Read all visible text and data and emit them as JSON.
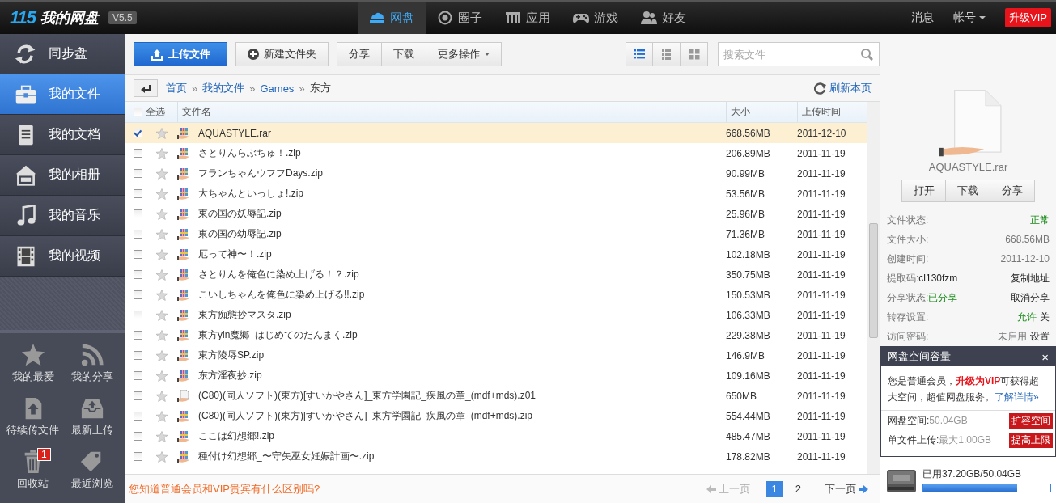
{
  "header": {
    "logo": "115",
    "title": "我的网盘",
    "version": "V5.5",
    "nav": [
      {
        "label": "网盘",
        "selected": true
      },
      {
        "label": "圈子",
        "selected": false
      },
      {
        "label": "应用",
        "selected": false
      },
      {
        "label": "游戏",
        "selected": false
      },
      {
        "label": "好友",
        "selected": false
      }
    ],
    "messages": "消息",
    "account": "帐号",
    "upgrade": "升级VIP"
  },
  "sidebar": {
    "items": [
      {
        "label": "同步盘",
        "selected": false
      },
      {
        "label": "我的文件",
        "selected": true
      },
      {
        "label": "我的文档",
        "selected": false
      },
      {
        "label": "我的相册",
        "selected": false
      },
      {
        "label": "我的音乐",
        "selected": false
      },
      {
        "label": "我的视频",
        "selected": false
      }
    ],
    "shortcuts": [
      {
        "label": "我的最爱"
      },
      {
        "label": "我的分享"
      },
      {
        "label": "待续传文件"
      },
      {
        "label": "最新上传"
      },
      {
        "label": "回收站",
        "badge": "1"
      },
      {
        "label": "最近浏览"
      }
    ]
  },
  "toolbar": {
    "upload": "上传文件",
    "new_folder": "新建文件夹",
    "actions": [
      "分享",
      "下载"
    ],
    "more": "更多操作",
    "views": [
      {
        "selected": true
      },
      {
        "selected": false
      },
      {
        "selected": false
      }
    ],
    "search": {
      "placeholder": "搜索文件"
    }
  },
  "breadcrumb": {
    "path": [
      {
        "label": "首页",
        "separator": "»"
      },
      {
        "label": "我的文件",
        "separator": "»"
      },
      {
        "label": "Games",
        "separator": "»"
      }
    ],
    "current": "东方",
    "refresh": "刷新本页"
  },
  "table": {
    "columns": [
      "全选",
      "文件名",
      "大小",
      "上传时间"
    ],
    "select_all_checked": false,
    "rows": [
      {
        "name": "AQUASTYLE.rar",
        "size": "668.56MB",
        "date": "2011-12-10",
        "kind": "archive",
        "checked": true
      },
      {
        "name": "さとりんらぶちゅ！.zip",
        "size": "206.89MB",
        "date": "2011-11-19",
        "kind": "archive",
        "checked": false
      },
      {
        "name": "フランちゃんウフフDays.zip",
        "size": "90.99MB",
        "date": "2011-11-19",
        "kind": "archive",
        "checked": false
      },
      {
        "name": "大ちゃんといっしょ!.zip",
        "size": "53.56MB",
        "date": "2011-11-19",
        "kind": "archive",
        "checked": false
      },
      {
        "name": "東の国の妖辱記.zip",
        "size": "25.96MB",
        "date": "2011-11-19",
        "kind": "archive",
        "checked": false
      },
      {
        "name": "東の国の幼辱記.zip",
        "size": "71.36MB",
        "date": "2011-11-19",
        "kind": "archive",
        "checked": false
      },
      {
        "name": "厄って神〜！.zip",
        "size": "102.18MB",
        "date": "2011-11-19",
        "kind": "archive",
        "checked": false
      },
      {
        "name": "さとりんを俺色に染め上げる！？.zip",
        "size": "350.75MB",
        "date": "2011-11-19",
        "kind": "archive",
        "checked": false
      },
      {
        "name": "こいしちゃんを俺色に染め上げる!!.zip",
        "size": "150.53MB",
        "date": "2011-11-19",
        "kind": "archive",
        "checked": false
      },
      {
        "name": "東方痴態抄マスタ.zip",
        "size": "106.33MB",
        "date": "2011-11-19",
        "kind": "archive",
        "checked": false
      },
      {
        "name": "東方yin魔鄉_はじめてのだんまく.zip",
        "size": "229.38MB",
        "date": "2011-11-19",
        "kind": "archive",
        "checked": false
      },
      {
        "name": "東方陵辱SP.zip",
        "size": "146.9MB",
        "date": "2011-11-19",
        "kind": "archive",
        "checked": false
      },
      {
        "name": "东方淫夜抄.zip",
        "size": "109.16MB",
        "date": "2011-11-19",
        "kind": "archive",
        "checked": false
      },
      {
        "name": "(C80)(同人ソフト)(東方)[すいかやさん]_東方学園記_疾風の章_(mdf+mds).z01",
        "size": "650MB",
        "date": "2011-11-19",
        "kind": "file",
        "checked": false
      },
      {
        "name": "(C80)(同人ソフト)(東方)[すいかやさん]_東方学園記_疾風の章_(mdf+mds).zip",
        "size": "554.44MB",
        "date": "2011-11-19",
        "kind": "archive",
        "checked": false
      },
      {
        "name": "ここは幻想郷!.zip",
        "size": "485.47MB",
        "date": "2011-11-19",
        "kind": "archive",
        "checked": false
      },
      {
        "name": "種付け幻想郷_〜守矢巫女妊娠計画〜.zip",
        "size": "178.82MB",
        "date": "2011-11-19",
        "kind": "archive",
        "checked": false
      }
    ]
  },
  "footer": {
    "tip": "您知道普通会员和VIP贵宾有什么区别吗?",
    "prev": "上一页",
    "pages": [
      {
        "label": "1",
        "selected": true
      },
      {
        "label": "2",
        "selected": false
      }
    ],
    "next": "下一页"
  },
  "details": {
    "file_name": "AQUASTYLE.rar",
    "buttons": [
      "打开",
      "下载",
      "分享"
    ],
    "fields": [
      {
        "label": "文件状态:",
        "value": "正常",
        "kind": "status"
      },
      {
        "label": "文件大小:",
        "value": "668.56MB",
        "kind": "info"
      },
      {
        "label": "创建时间:",
        "value": "2011-12-10",
        "kind": "info"
      },
      {
        "label": "提取码:",
        "value": "cl130fzm",
        "kind": "code",
        "action": "复制地址"
      },
      {
        "label": "分享状态:",
        "value": "已分享",
        "kind": "status",
        "action": "取消分享"
      },
      {
        "label": "转存设置:",
        "value": "允许",
        "kind": "status",
        "action": "关"
      },
      {
        "label": "访问密码:",
        "value": "未启用",
        "kind": "info",
        "action": "设置"
      }
    ]
  },
  "capacity_popup": {
    "title": "网盘空间容量",
    "close": "×",
    "message": "您是普通会员，**升级为VIP**可获得超大空间，超值网盘服务。",
    "link": "了解详情»",
    "rows": [
      {
        "label": "网盘空间:",
        "value": "50.04GB",
        "button": "扩容空间"
      },
      {
        "label": "单文件上传:",
        "value": "最大1.00GB",
        "button": "提高上限"
      }
    ]
  },
  "storage": {
    "used": "已用37.20GB/50.04GB",
    "level": 0.74
  }
}
